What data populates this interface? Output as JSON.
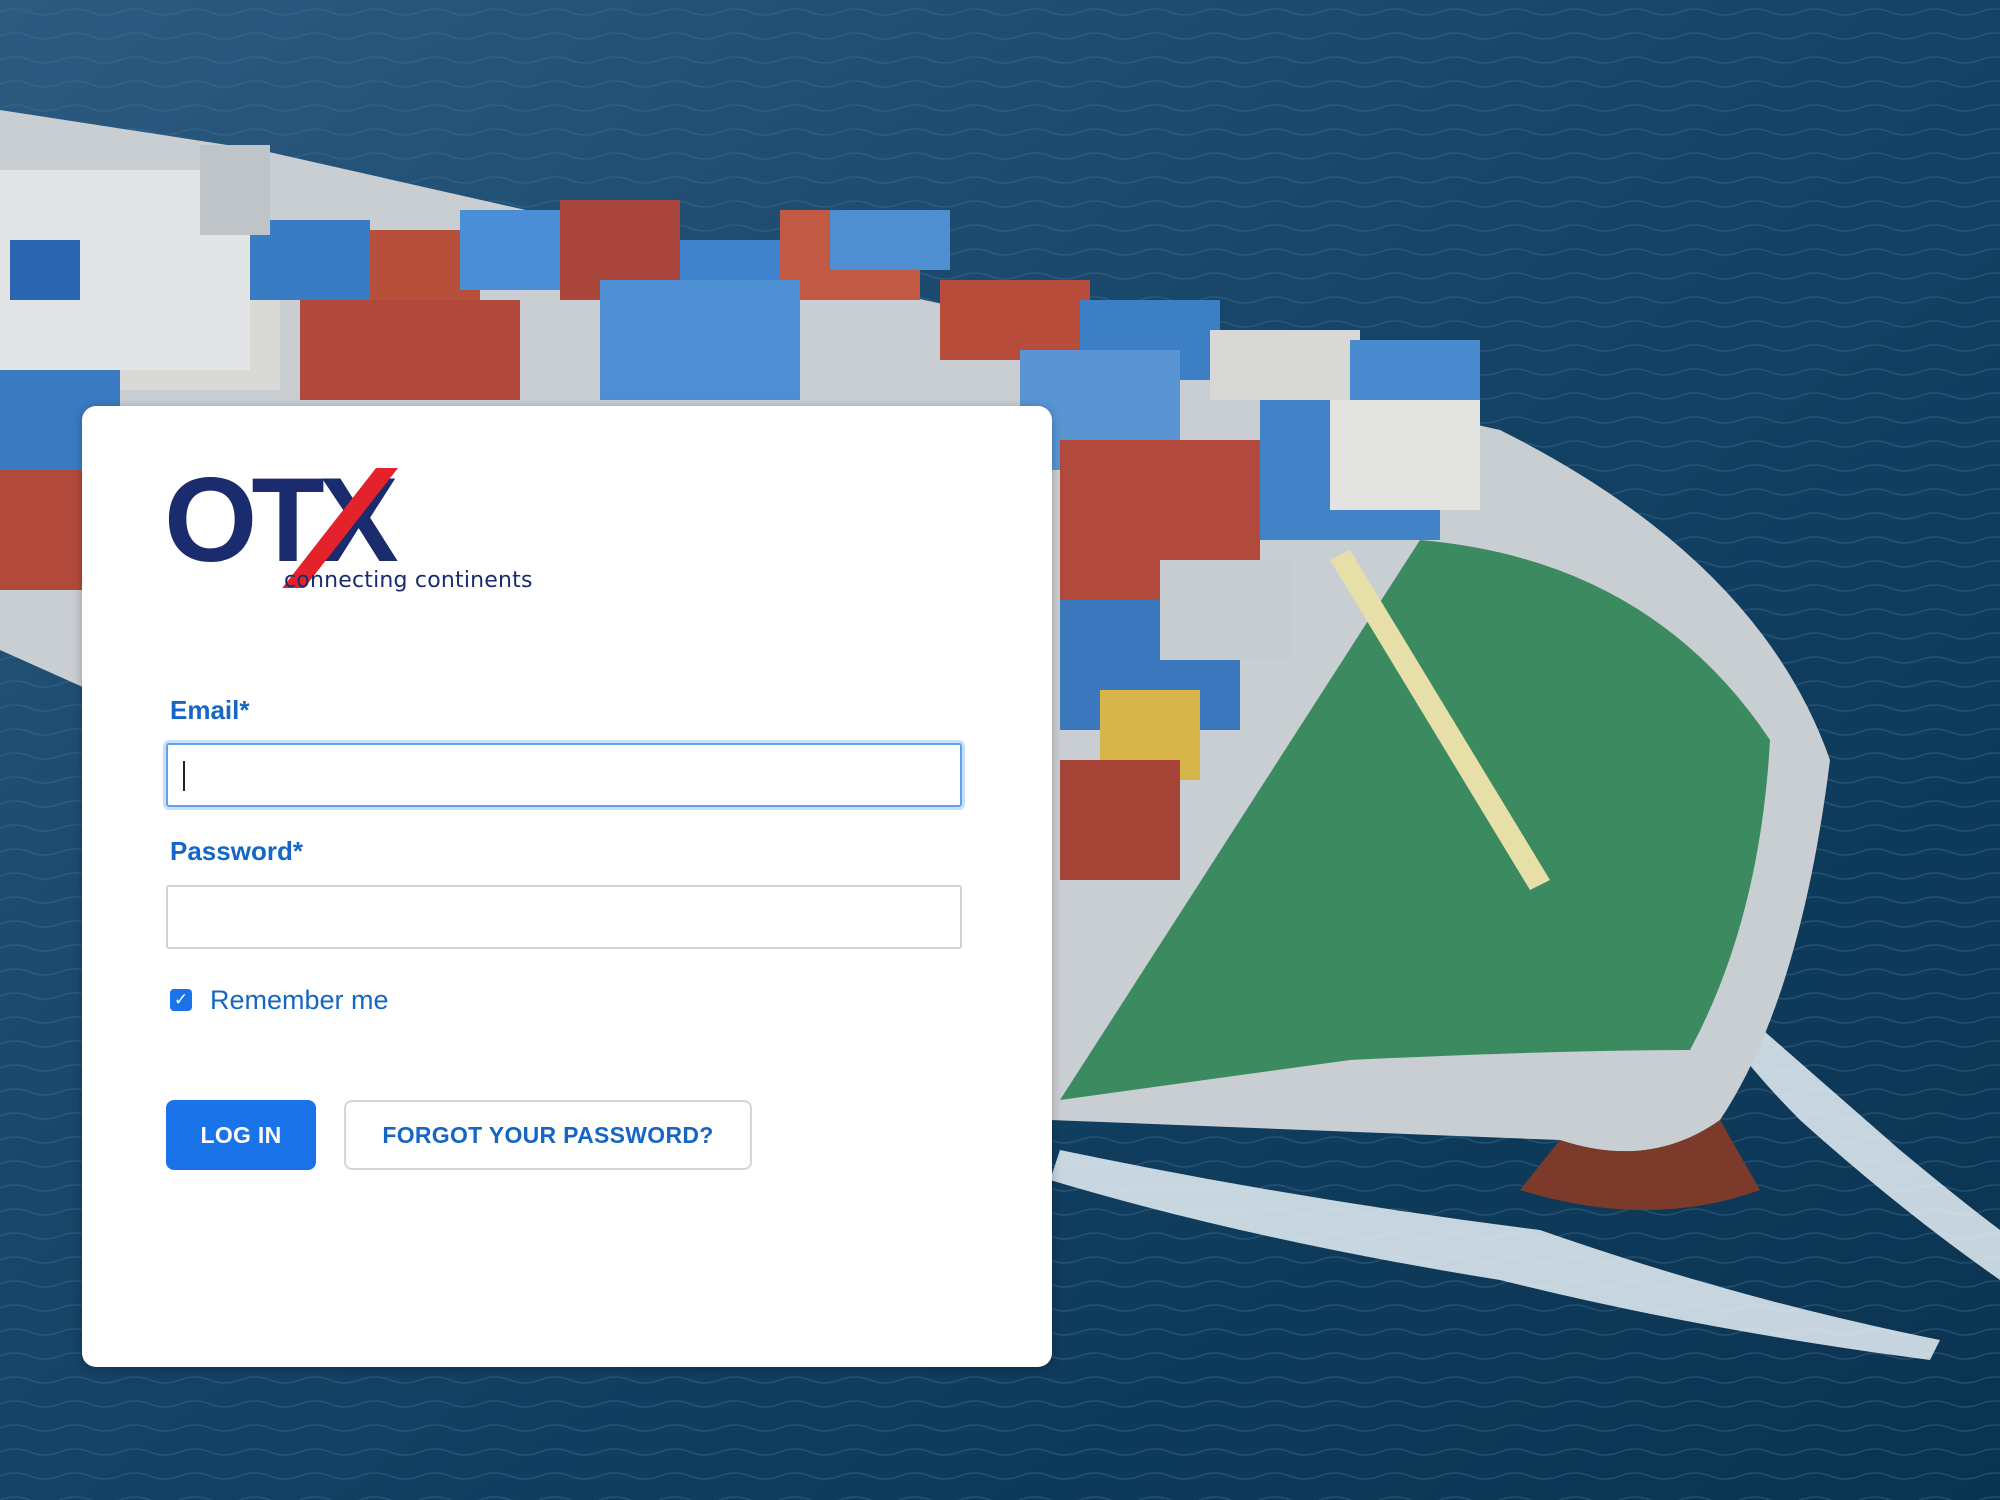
{
  "brand": {
    "wordmark": "OTX",
    "tagline": "connecting continents",
    "colors": {
      "navy": "#1a2c6e",
      "red": "#e3222b"
    }
  },
  "form": {
    "email_label": "Email*",
    "email_value": "",
    "password_label": "Password*",
    "password_value": "",
    "remember_label": "Remember me",
    "remember_checked": true,
    "login_button": "LOG IN",
    "forgot_button": "FORGOT YOUR PASSWORD?"
  },
  "theme": {
    "accent": "#1a73e8",
    "label_color": "#1666c5"
  },
  "background": {
    "scene": "aerial-container-ship-photo"
  }
}
